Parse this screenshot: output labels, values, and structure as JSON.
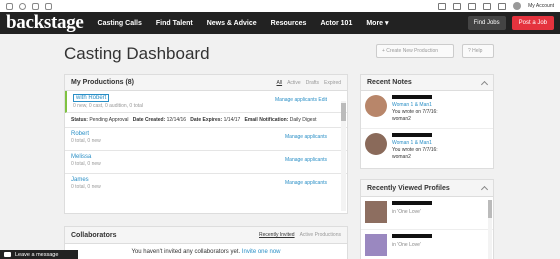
{
  "topbar": {
    "account_label": "My Account"
  },
  "nav": {
    "logo": "backstage",
    "items": [
      "Casting Calls",
      "Find Talent",
      "News & Advice",
      "Resources",
      "Actor 101",
      "More ▾"
    ],
    "find_jobs": "Find Jobs",
    "post_job": "Post a Job"
  },
  "page": {
    "title": "Casting Dashboard",
    "create_production": "+ Create New Production",
    "help": "? Help"
  },
  "productions": {
    "title": "My Productions (8)",
    "filters": [
      "All",
      "Active",
      "Drafts",
      "Expired"
    ],
    "rows": [
      {
        "name": "with Robert",
        "sub": "0 new, 0 cast, 0 audition, 0 total",
        "manage": "Manage applicants",
        "edit": "Edit",
        "status_label": "Status:",
        "status": "Pending Approval",
        "created_label": "Date Created:",
        "created": "12/14/16",
        "expires_label": "Date Expires:",
        "expires": "1/14/17",
        "email_label": "Email Notification:",
        "email": "Daily Digest"
      },
      {
        "name": "Robert",
        "sub": "0 total, 0 new",
        "manage": "Manage applicants"
      },
      {
        "name": "Melissa",
        "sub": "0 total, 0 new",
        "manage": "Manage applicants"
      },
      {
        "name": "James",
        "sub": "0 total, 0 new",
        "manage": "Manage applicants"
      }
    ]
  },
  "collaborators": {
    "title": "Collaborators",
    "tabs": [
      "Recently Invited",
      "Active Productions"
    ],
    "empty_text": "You haven't invited any collaborators yet.",
    "invite_link": "Invite one now"
  },
  "notes": {
    "title": "Recent Notes",
    "items": [
      {
        "role": "Woman 1 & Man1",
        "wrote": "You wrote on 7/7/16:",
        "text": "woman2"
      },
      {
        "role": "Woman 1 & Man1",
        "wrote": "You wrote on 7/7/16:",
        "text": "woman2"
      }
    ]
  },
  "profiles": {
    "title": "Recently Viewed Profiles",
    "items": [
      {
        "production": "in 'One Love'"
      },
      {
        "production": "in 'One Love'"
      }
    ]
  },
  "chat": {
    "label": "Leave a message"
  },
  "colors": {
    "accent": "#2a8fc6",
    "brand_red": "#e5333e",
    "nav_bg": "#222222"
  }
}
